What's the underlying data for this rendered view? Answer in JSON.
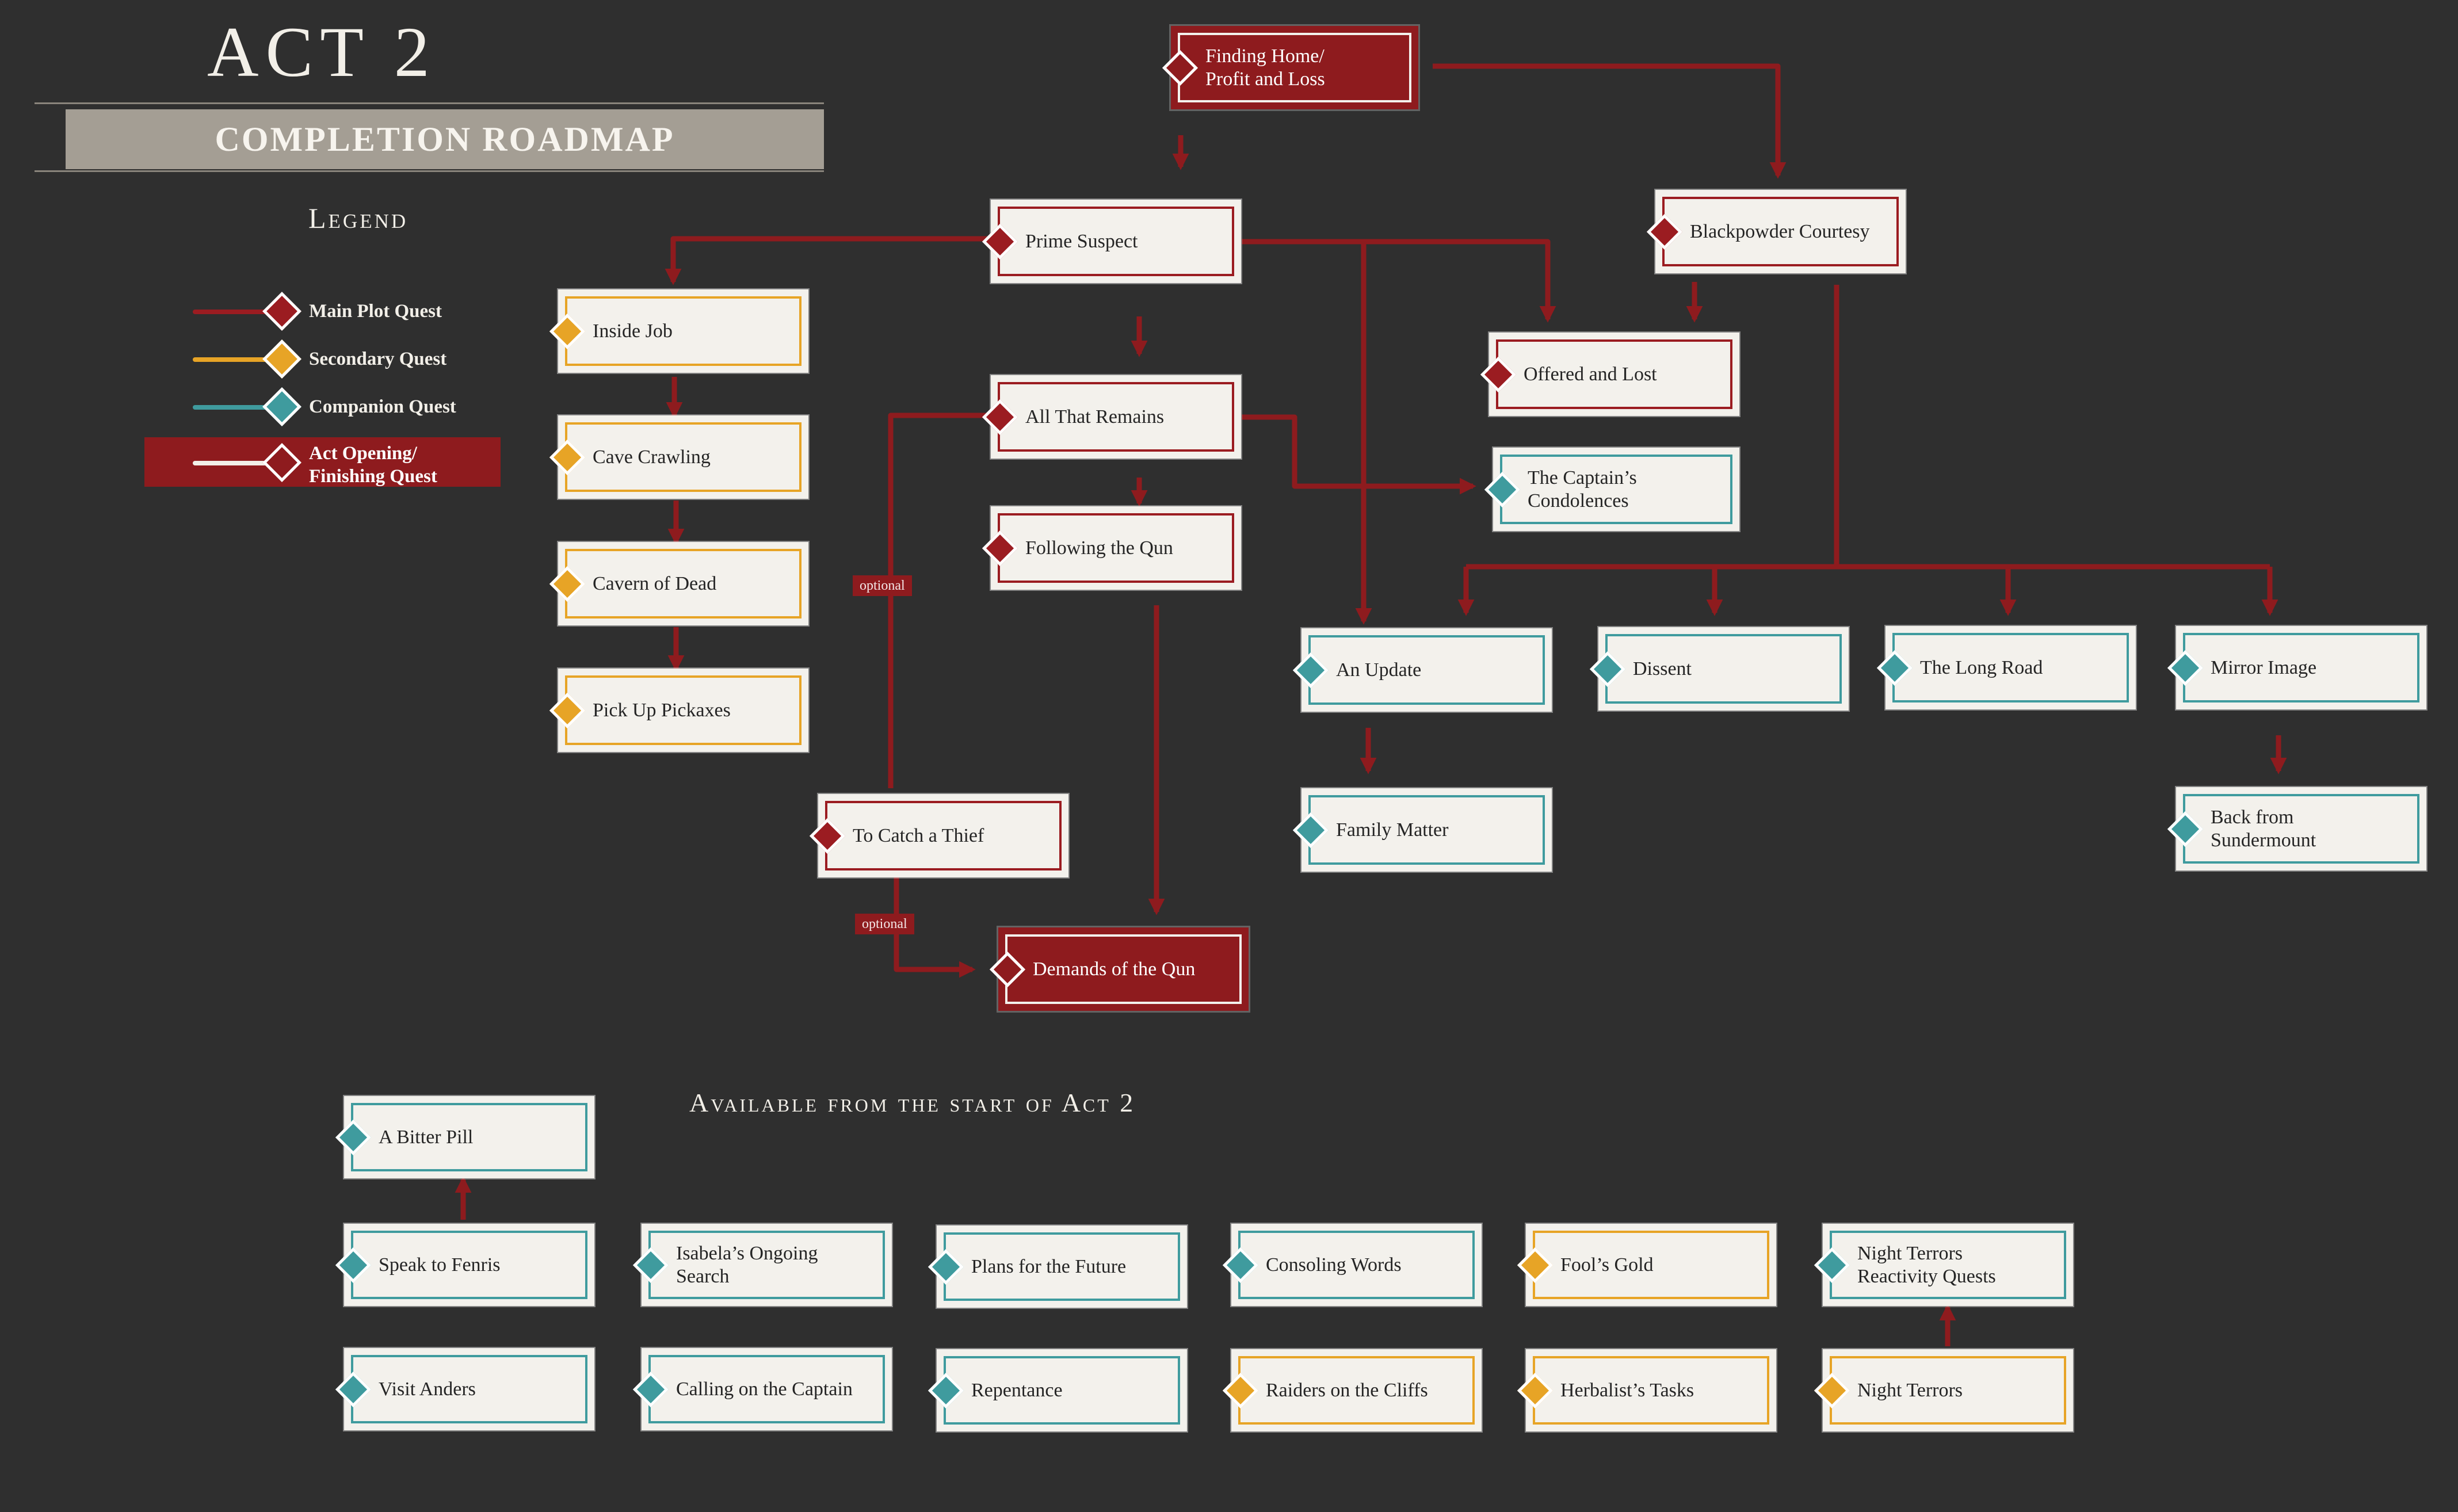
{
  "title": "ACT 2",
  "banner": "COMPLETION ROADMAP",
  "legend": {
    "title": "Legend",
    "items": [
      {
        "label": "Main Plot Quest",
        "color": "#9b1c21"
      },
      {
        "label": "Secondary Quest",
        "color": "#e7a426"
      },
      {
        "label": "Companion Quest",
        "color": "#3f9b9e"
      },
      {
        "label": "Act Opening/\nFinishing Quest",
        "color": "#8e1b1e"
      }
    ]
  },
  "quests": {
    "finding_home": "Finding Home/\nProfit and Loss",
    "prime_suspect": "Prime Suspect",
    "blackpowder": "Blackpowder Courtesy",
    "inside_job": "Inside Job",
    "cave_crawling": "Cave Crawling",
    "cavern_dead": "Cavern of Dead",
    "pick_up": "Pick Up Pickaxes",
    "all_that_remains": "All That Remains",
    "following_qun": "Following the Qun",
    "offered_lost": "Offered and Lost",
    "captains_condolences": "The Captain’s\nCondolences",
    "an_update": "An Update",
    "dissent": "Dissent",
    "long_road": "The Long Road",
    "mirror_image": "Mirror Image",
    "family_matter": "Family Matter",
    "back_from": "Back from\nSundermount",
    "catch_thief": "To Catch a Thief",
    "demands_qun": "Demands of the Qun"
  },
  "tags": {
    "optional_1": "optional",
    "optional_2": "optional"
  },
  "start_section": {
    "title": "Available from the start of Act 2",
    "quests": {
      "bitter_pill": "A Bitter Pill",
      "speak_fenris": "Speak to Fenris",
      "visit_anders": "Visit Anders",
      "isabela": "Isabela’s Ongoing\nSearch",
      "calling_captain": "Calling on the Captain",
      "plans_future": "Plans for the Future",
      "repentance": "Repentance",
      "consoling": "Consoling Words",
      "raiders": "Raiders on the Cliffs",
      "fools_gold": "Fool’s Gold",
      "herbalist": "Herbalist’s Tasks",
      "night_terrors_react": "Night Terrors\nReactivity Quests",
      "night_terrors": "Night Terrors"
    }
  },
  "colors": {
    "background": "#2f2f2f",
    "main": "#9b1c21",
    "secondary": "#e7a426",
    "companion": "#3f9b9e",
    "finishing": "#8e1b1e",
    "connector": "#8e1b1e"
  }
}
